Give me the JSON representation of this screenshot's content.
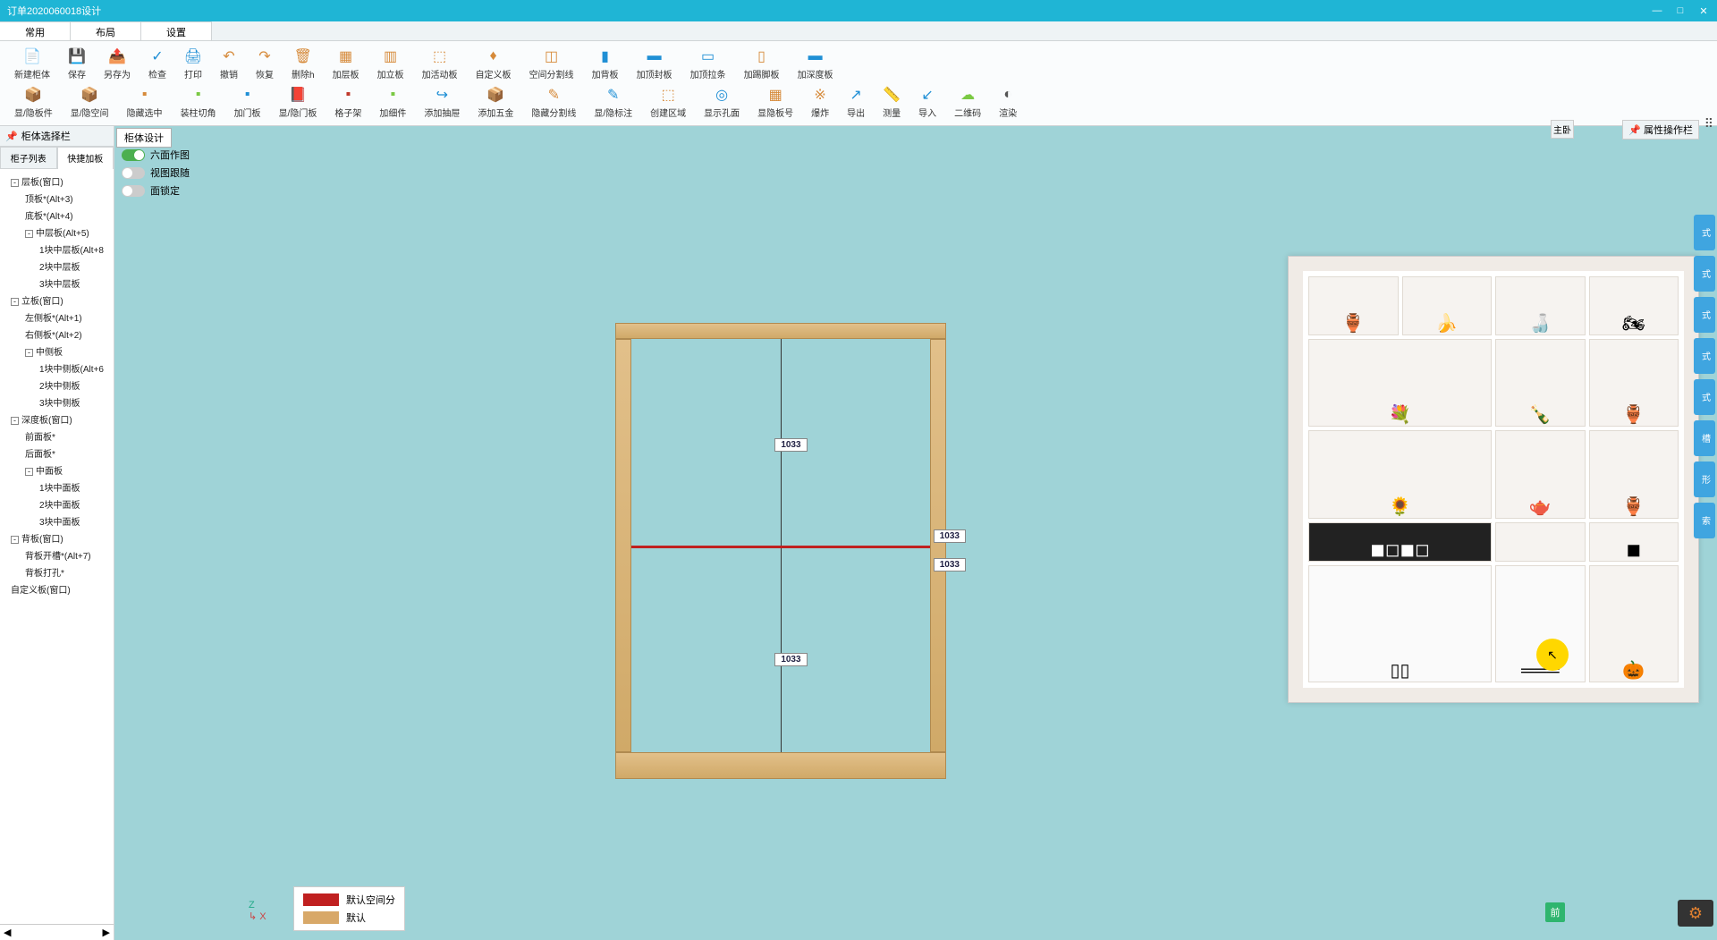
{
  "window": {
    "title": "订单2020060018设计"
  },
  "menu_tabs": [
    "常用",
    "布局",
    "设置"
  ],
  "ribbon_row1": [
    {
      "icon": "📄",
      "label": "新建柜体",
      "c": "#1f8fd5"
    },
    {
      "icon": "💾",
      "label": "保存",
      "c": "#1f8fd5"
    },
    {
      "icon": "📤",
      "label": "另存为",
      "c": "#1f8fd5"
    },
    {
      "icon": "✓",
      "label": "检查",
      "c": "#1f8fd5"
    },
    {
      "icon": "🖨",
      "label": "打印",
      "c": "#1f8fd5"
    },
    {
      "icon": "↶",
      "label": "撤销",
      "c": "#d68a3a"
    },
    {
      "icon": "↷",
      "label": "恢复",
      "c": "#d68a3a"
    },
    {
      "icon": "🗑",
      "label": "删除h",
      "c": "#d68a3a"
    },
    {
      "icon": "▦",
      "label": "加层板",
      "c": "#d68a3a"
    },
    {
      "icon": "▥",
      "label": "加立板",
      "c": "#d68a3a"
    },
    {
      "icon": "⬚",
      "label": "加活动板",
      "c": "#d68a3a"
    },
    {
      "icon": "♦",
      "label": "自定义板",
      "c": "#d68a3a"
    },
    {
      "icon": "◫",
      "label": "空间分割线",
      "c": "#d68a3a"
    },
    {
      "icon": "▮",
      "label": "加背板",
      "c": "#1f8fd5"
    },
    {
      "icon": "▬",
      "label": "加顶封板",
      "c": "#1f8fd5"
    },
    {
      "icon": "▭",
      "label": "加顶拉条",
      "c": "#1f8fd5"
    },
    {
      "icon": "▯",
      "label": "加踢脚板",
      "c": "#d68a3a"
    },
    {
      "icon": "▬",
      "label": "加深度板",
      "c": "#1f8fd5"
    }
  ],
  "ribbon_row2": [
    {
      "icon": "📦",
      "label": "显/隐板件",
      "c": "#d68a3a"
    },
    {
      "icon": "📦",
      "label": "显/隐空间",
      "c": "#d68a3a"
    },
    {
      "icon": "▪",
      "label": "隐藏选中",
      "c": "#d68a3a"
    },
    {
      "icon": "▪",
      "label": "装柱切角",
      "c": "#7ac943"
    },
    {
      "icon": "▪",
      "label": "加门板",
      "c": "#1f8fd5"
    },
    {
      "icon": "📕",
      "label": "显/隐门板",
      "c": "#c0392b"
    },
    {
      "icon": "▪",
      "label": "格子架",
      "c": "#c0392b"
    },
    {
      "icon": "▪",
      "label": "加细件",
      "c": "#7ac943"
    },
    {
      "icon": "↪",
      "label": "添加抽屉",
      "c": "#1f8fd5"
    },
    {
      "icon": "📦",
      "label": "添加五金",
      "c": "#d68a3a"
    },
    {
      "icon": "✎",
      "label": "隐藏分割线",
      "c": "#d68a3a"
    },
    {
      "icon": "✎",
      "label": "显/隐标注",
      "c": "#1f8fd5"
    },
    {
      "icon": "⬚",
      "label": "创建区域",
      "c": "#d68a3a"
    },
    {
      "icon": "◎",
      "label": "显示孔面",
      "c": "#1f8fd5"
    },
    {
      "icon": "▦",
      "label": "显隐板号",
      "c": "#d68a3a"
    },
    {
      "icon": "※",
      "label": "爆炸",
      "c": "#d68a3a"
    },
    {
      "icon": "↗",
      "label": "导出",
      "c": "#1f8fd5"
    },
    {
      "icon": "📏",
      "label": "测量",
      "c": "#1f8fd5"
    },
    {
      "icon": "↙",
      "label": "导入",
      "c": "#1f8fd5"
    },
    {
      "icon": "☁",
      "label": "二维码",
      "c": "#7ac943"
    },
    {
      "icon": "◐",
      "label": "渲染",
      "c": "#555"
    }
  ],
  "left_panel": {
    "title": "柜体选择栏",
    "tabs": [
      "柜子列表",
      "快捷加板"
    ],
    "tree": [
      {
        "lvl": 1,
        "t": "层板(窗口)",
        "exp": true
      },
      {
        "lvl": 2,
        "t": "顶板*(Alt+3)"
      },
      {
        "lvl": 2,
        "t": "底板*(Alt+4)"
      },
      {
        "lvl": 2,
        "t": "中层板(Alt+5)",
        "exp": true
      },
      {
        "lvl": 3,
        "t": "1块中层板(Alt+8"
      },
      {
        "lvl": 3,
        "t": "2块中层板"
      },
      {
        "lvl": 3,
        "t": "3块中层板"
      },
      {
        "lvl": 1,
        "t": "立板(窗口)",
        "exp": true
      },
      {
        "lvl": 2,
        "t": "左侧板*(Alt+1)"
      },
      {
        "lvl": 2,
        "t": "右侧板*(Alt+2)"
      },
      {
        "lvl": 2,
        "t": "中侧板",
        "exp": true
      },
      {
        "lvl": 3,
        "t": "1块中侧板(Alt+6"
      },
      {
        "lvl": 3,
        "t": "2块中侧板"
      },
      {
        "lvl": 3,
        "t": "3块中侧板"
      },
      {
        "lvl": 1,
        "t": "深度板(窗口)",
        "exp": true
      },
      {
        "lvl": 2,
        "t": "前面板*"
      },
      {
        "lvl": 2,
        "t": "后面板*"
      },
      {
        "lvl": 2,
        "t": "中面板",
        "exp": true
      },
      {
        "lvl": 3,
        "t": "1块中面板"
      },
      {
        "lvl": 3,
        "t": "2块中面板"
      },
      {
        "lvl": 3,
        "t": "3块中面板"
      },
      {
        "lvl": 1,
        "t": "背板(窗口)",
        "exp": true
      },
      {
        "lvl": 2,
        "t": "背板开槽*(Alt+7)"
      },
      {
        "lvl": 2,
        "t": "背板打孔*"
      },
      {
        "lvl": 1,
        "t": "自定义板(窗口)"
      }
    ]
  },
  "canvas": {
    "tab": "柜体设计",
    "toggles": [
      {
        "label": "六面作图",
        "on": true
      },
      {
        "label": "视图跟随",
        "on": false
      },
      {
        "label": "面锁定",
        "on": false
      }
    ],
    "dims": {
      "top": "1033",
      "mid1": "1033",
      "mid2": "1033",
      "bot": "1033"
    }
  },
  "axis": {
    "z": "Z",
    "x": "X"
  },
  "legend": [
    {
      "color": "#c02020",
      "label": "默认空间分"
    },
    {
      "color": "#d8a868",
      "label": "默认"
    }
  ],
  "right": {
    "main_label": "主卧",
    "prop_label": "属性操作栏",
    "front": "前",
    "buttons": [
      "式",
      "式",
      "式",
      "式",
      "式",
      "槽",
      "形",
      "索"
    ]
  }
}
